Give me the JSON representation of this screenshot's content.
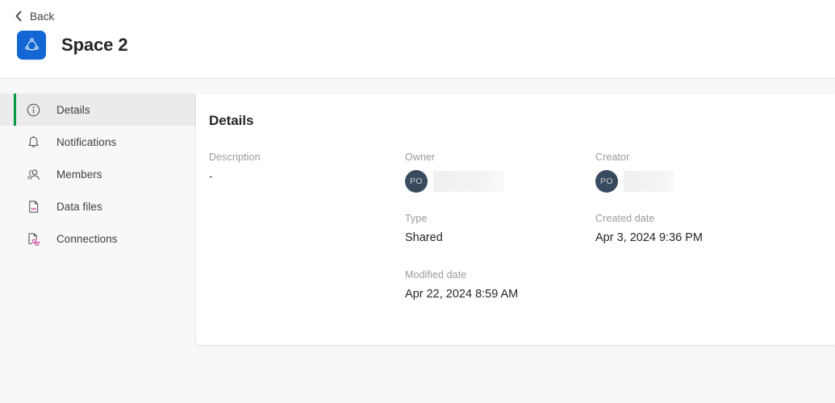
{
  "header": {
    "back_label": "Back",
    "back_icon": "chevron-left-icon",
    "space_icon": "space-logo-icon",
    "space_title": "Space 2",
    "accent_color": "#1267d4"
  },
  "sidebar": {
    "active_marker_color": "#009845",
    "items": [
      {
        "label": "Details",
        "icon": "info-circle-icon",
        "active": true
      },
      {
        "label": "Notifications",
        "icon": "bell-icon",
        "active": false
      },
      {
        "label": "Members",
        "icon": "people-icon",
        "active": false
      },
      {
        "label": "Data files",
        "icon": "file-data-icon",
        "active": false
      },
      {
        "label": "Connections",
        "icon": "connections-icon",
        "active": false
      }
    ]
  },
  "main": {
    "title": "Details",
    "fields": {
      "description": {
        "label": "Description",
        "value": "-"
      },
      "owner": {
        "label": "Owner",
        "avatar_initials": "PO",
        "value_redacted": true
      },
      "creator": {
        "label": "Creator",
        "avatar_initials": "PO",
        "value_redacted": true
      },
      "type": {
        "label": "Type",
        "value": "Shared"
      },
      "created_date": {
        "label": "Created date",
        "value": "Apr 3, 2024 9:36 PM"
      },
      "modified_date": {
        "label": "Modified date",
        "value": "Apr 22, 2024 8:59 AM"
      }
    },
    "avatar_color": "#374a5e"
  }
}
